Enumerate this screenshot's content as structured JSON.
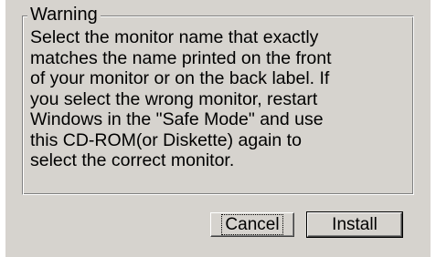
{
  "dialog": {
    "group_title": "Warning",
    "message": "Select the monitor name that exactly\nmatches the name printed on the front\nof your monitor or on the back label. If\nyou select the wrong monitor, restart\nWindows in the \"Safe Mode\" and use\nthis CD-ROM(or Diskette) again to\nselect the correct monitor.",
    "buttons": {
      "cancel_label": "Cancel",
      "install_label": "Install"
    },
    "colors": {
      "face": "#d6d3ce",
      "shadow": "#808080",
      "highlight": "#ffffff"
    }
  }
}
